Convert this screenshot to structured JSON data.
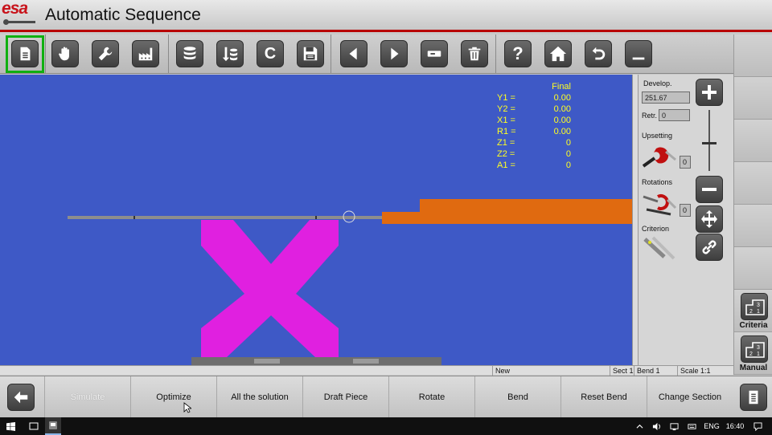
{
  "app": {
    "logo_text": "esa",
    "title": "Automatic Sequence"
  },
  "toolbar": {
    "buttons": [
      {
        "name": "document-icon",
        "selected": true
      },
      {
        "name": "hand-icon"
      },
      {
        "name": "wrench-icon"
      },
      {
        "name": "factory-icon"
      },
      {
        "name": "database-icon"
      },
      {
        "name": "sort-database-icon"
      },
      {
        "name": "c-icon",
        "glyph": "C"
      },
      {
        "name": "save-icon"
      },
      {
        "name": "arrow-left-icon"
      },
      {
        "name": "arrow-right-icon"
      },
      {
        "name": "minus-slot-icon"
      },
      {
        "name": "trash-icon"
      },
      {
        "name": "help-icon",
        "glyph": "?"
      },
      {
        "name": "home-icon"
      },
      {
        "name": "undo-icon"
      },
      {
        "name": "minimize-icon"
      }
    ]
  },
  "readout": {
    "header": "Final",
    "rows": [
      {
        "label": "Y1 =",
        "value": "0.00"
      },
      {
        "label": "Y2 =",
        "value": "0.00"
      },
      {
        "label": "X1 =",
        "value": "0.00"
      },
      {
        "label": "R1 =",
        "value": "0.00"
      },
      {
        "label": "Z1 =",
        "value": "0"
      },
      {
        "label": "Z2 =",
        "value": "0"
      },
      {
        "label": "A1 =",
        "value": "0"
      }
    ]
  },
  "panel": {
    "develop_label": "Develop.",
    "develop_value": "251.67",
    "retr_label": "Retr.",
    "retr_value": "0",
    "upsetting_label": "Upsetting",
    "upsetting_value": "0",
    "rotations_label": "Rotations",
    "rotations_value": "0",
    "criterion_label": "Criterion"
  },
  "rail": {
    "criteria_label": "Criteria",
    "manual_label": "Manual"
  },
  "status": {
    "state": "New",
    "sect": "Sect 1",
    "bend": "Bend 1",
    "scale": "Scale 1:1"
  },
  "bottom": {
    "items": [
      "Simulate",
      "Optimize",
      "All the solution",
      "Draft Piece",
      "Rotate",
      "Bend",
      "Reset Bend",
      "Change Section"
    ]
  },
  "taskbar": {
    "language": "ENG",
    "time": "16:40"
  },
  "colors": {
    "canvas_bg": "#3e59c6",
    "readout_text": "#ffff22",
    "tool_color": "#e020e0",
    "sheet_color": "#e06a10",
    "selected_frame": "#10b010",
    "header_rule": "#b80000"
  }
}
